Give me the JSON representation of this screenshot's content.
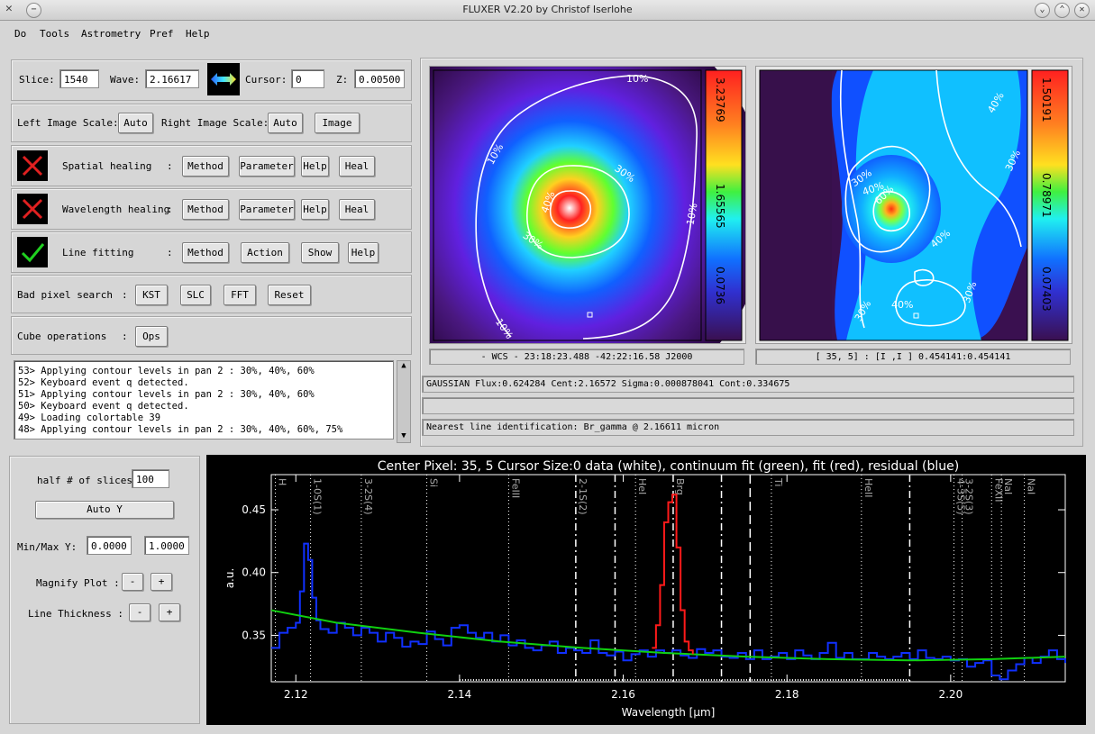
{
  "window": {
    "title": "FLUXER V2.20 by Christof Iserlohe"
  },
  "menu": [
    "Do",
    "Tools",
    "Astrometry",
    "Pref",
    "Help"
  ],
  "controls": {
    "slice_label": "Slice:",
    "slice_value": "1540",
    "wave_label": "Wave:",
    "wave_value": "2.16617",
    "cursor_label": "Cursor:",
    "cursor_value": "0",
    "z_label": "Z:",
    "z_value": "0.00500"
  },
  "scale": {
    "left_label": "Left Image Scale:",
    "left_button": "Auto",
    "right_label": "Right Image Scale:",
    "right_button": "Auto",
    "image_button": "Image"
  },
  "spatial": {
    "label": "Spatial healing",
    "colon": ":",
    "method": "Method",
    "parameter": "Parameter",
    "help": "Help",
    "heal": "Heal",
    "state": "off"
  },
  "wavelength": {
    "label": "Wavelength healing",
    "colon": ":",
    "method": "Method",
    "parameter": "Parameter",
    "help": "Help",
    "heal": "Heal",
    "state": "off"
  },
  "linefit": {
    "label": "Line fitting",
    "colon": ":",
    "method": "Method",
    "action": "Action",
    "show": "Show",
    "help": "Help",
    "state": "on"
  },
  "badpix": {
    "label": "Bad pixel search",
    "colon": ":",
    "kst": "KST",
    "slc": "SLC",
    "fft": "FFT",
    "reset": "Reset"
  },
  "cube": {
    "label": "Cube operations",
    "colon": ":",
    "ops": "Ops"
  },
  "log": [
    "53> Applying contour levels in pan 2 : 30%, 40%, 60%",
    "52> Keyboard event q detected.",
    "51> Applying contour levels in pan 2 : 30%, 40%, 60%",
    "50> Keyboard event q detected.",
    "49> Loading colortable 39",
    "48> Applying contour levels in pan 2 : 30%, 40%, 60%, 75%"
  ],
  "plotctl": {
    "half_label": "half # of slices",
    "half_value": "100",
    "auto_y": "Auto Y",
    "minmax_label": "Min/Max Y:",
    "min_value": "0.0000",
    "max_value": "1.0000",
    "magnify_label": "Magnify Plot :",
    "minus": "-",
    "plus": "+",
    "thick_label": "Line Thickness :"
  },
  "images": {
    "left_colorbar": [
      "3.23769",
      "1.65565",
      "0.0736"
    ],
    "right_colorbar": [
      "1.50191",
      "0.78971",
      "0.07403"
    ],
    "left_contours": [
      "10%",
      "10%",
      "30%",
      "30%",
      "40%",
      "10%",
      "10%"
    ],
    "right_contours": [
      "40%",
      "30%",
      "40%",
      "60%",
      "40%",
      "30%",
      "40%",
      "30%",
      "30%"
    ],
    "left_status": "- WCS -   23:18:23.488  -42:22:16.58  J2000",
    "right_status": "[ 35,  5] : [I ,I ] 0.454141:0.454141"
  },
  "fit": {
    "line1": "GAUSSIAN  Flux:0.624284 Cent:2.16572 Sigma:0.000878041 Cont:0.334675",
    "line2": "",
    "line3": "Nearest line identification: Br_gamma @ 2.16611 micron"
  },
  "chart_data": {
    "type": "line",
    "title": "Center Pixel: 35, 5  Cursor Size:0  data (white), continuum fit (green), fit (red), residual (blue)",
    "xlabel": "Wavelength [μm]",
    "ylabel": "a.u.",
    "xlim": [
      2.117,
      2.214
    ],
    "ylim": [
      0.313,
      0.478
    ],
    "xticks": [
      2.12,
      2.14,
      2.16,
      2.18,
      2.2
    ],
    "xtick_labels": [
      "2.12",
      "2.14",
      "2.16",
      "2.18",
      "2.20"
    ],
    "yticks": [
      0.35,
      0.4,
      0.45
    ],
    "ytick_labels": [
      "0.35",
      "0.40",
      "0.45"
    ],
    "line_ids": [
      {
        "label": "H",
        "x": 2.1175
      },
      {
        "label": "1-0S(1)",
        "x": 2.1218
      },
      {
        "label": "3-2S(4)",
        "x": 2.128
      },
      {
        "label": "Si",
        "x": 2.136
      },
      {
        "label": "FeIII",
        "x": 2.146
      },
      {
        "label": "2-1S(2)",
        "x": 2.1542
      },
      {
        "label": "HeI",
        "x": 2.1615
      },
      {
        "label": "Brg",
        "x": 2.1661
      },
      {
        "label": "Ti",
        "x": 2.1781
      },
      {
        "label": "HeII",
        "x": 2.1891
      },
      {
        "label": "4-3S(5)",
        "x": 2.2004
      },
      {
        "label": "3-2S(3)",
        "x": 2.2014
      },
      {
        "label": "FeXII",
        "x": 2.205
      },
      {
        "label": "NaI",
        "x": 2.2062
      },
      {
        "label": "NaI",
        "x": 2.209
      }
    ],
    "series": [
      {
        "name": "residual (blue)",
        "color": "#1030ff",
        "x": [
          2.117,
          2.118,
          2.119,
          2.12,
          2.1205,
          2.121,
          2.1215,
          2.122,
          2.1225,
          2.123,
          2.124,
          2.125,
          2.126,
          2.127,
          2.128,
          2.129,
          2.13,
          2.131,
          2.132,
          2.133,
          2.134,
          2.135,
          2.136,
          2.137,
          2.138,
          2.139,
          2.14,
          2.141,
          2.142,
          2.143,
          2.144,
          2.145,
          2.146,
          2.147,
          2.148,
          2.149,
          2.15,
          2.151,
          2.152,
          2.153,
          2.154,
          2.155,
          2.156,
          2.157,
          2.158,
          2.159,
          2.16,
          2.161,
          2.162,
          2.163,
          2.164,
          2.165,
          2.166,
          2.167,
          2.168,
          2.169,
          2.17,
          2.171,
          2.172,
          2.173,
          2.174,
          2.175,
          2.176,
          2.177,
          2.178,
          2.179,
          2.18,
          2.181,
          2.182,
          2.183,
          2.184,
          2.185,
          2.186,
          2.187,
          2.188,
          2.189,
          2.19,
          2.191,
          2.192,
          2.193,
          2.194,
          2.195,
          2.196,
          2.197,
          2.198,
          2.199,
          2.2,
          2.201,
          2.202,
          2.203,
          2.204,
          2.205,
          2.206,
          2.207,
          2.208,
          2.209,
          2.21,
          2.211,
          2.212,
          2.213,
          2.214
        ],
        "y": [
          0.34,
          0.352,
          0.356,
          0.36,
          0.385,
          0.423,
          0.41,
          0.38,
          0.362,
          0.355,
          0.352,
          0.36,
          0.356,
          0.35,
          0.356,
          0.352,
          0.345,
          0.352,
          0.348,
          0.341,
          0.345,
          0.343,
          0.353,
          0.347,
          0.342,
          0.356,
          0.358,
          0.352,
          0.348,
          0.352,
          0.345,
          0.35,
          0.342,
          0.346,
          0.34,
          0.338,
          0.342,
          0.345,
          0.336,
          0.34,
          0.338,
          0.336,
          0.346,
          0.336,
          0.334,
          0.337,
          0.33,
          0.335,
          0.338,
          0.333,
          0.338,
          0.336,
          0.338,
          0.334,
          0.332,
          0.339,
          0.336,
          0.338,
          0.333,
          0.332,
          0.336,
          0.331,
          0.338,
          0.331,
          0.333,
          0.336,
          0.331,
          0.338,
          0.334,
          0.331,
          0.336,
          0.344,
          0.332,
          0.336,
          0.331,
          0.331,
          0.336,
          0.333,
          0.331,
          0.333,
          0.336,
          0.331,
          0.338,
          0.332,
          0.331,
          0.333,
          0.33,
          0.331,
          0.325,
          0.328,
          0.33,
          0.318,
          0.315,
          0.322,
          0.327,
          0.332,
          0.328,
          0.333,
          0.338,
          0.331,
          0.328
        ]
      },
      {
        "name": "continuum fit (green)",
        "color": "#10d010",
        "x": [
          2.117,
          2.125,
          2.135,
          2.145,
          2.155,
          2.165,
          2.175,
          2.185,
          2.195,
          2.205,
          2.214
        ],
        "y": [
          0.37,
          0.36,
          0.352,
          0.345,
          0.34,
          0.336,
          0.333,
          0.331,
          0.33,
          0.331,
          0.333
        ]
      },
      {
        "name": "fit (red)",
        "color": "#ff1a1a",
        "x": [
          2.1635,
          2.164,
          2.1645,
          2.165,
          2.1655,
          2.166,
          2.1665,
          2.167,
          2.1675,
          2.168,
          2.1685
        ],
        "y": [
          0.34,
          0.358,
          0.39,
          0.44,
          0.456,
          0.462,
          0.42,
          0.37,
          0.345,
          0.338,
          0.335
        ]
      }
    ]
  }
}
